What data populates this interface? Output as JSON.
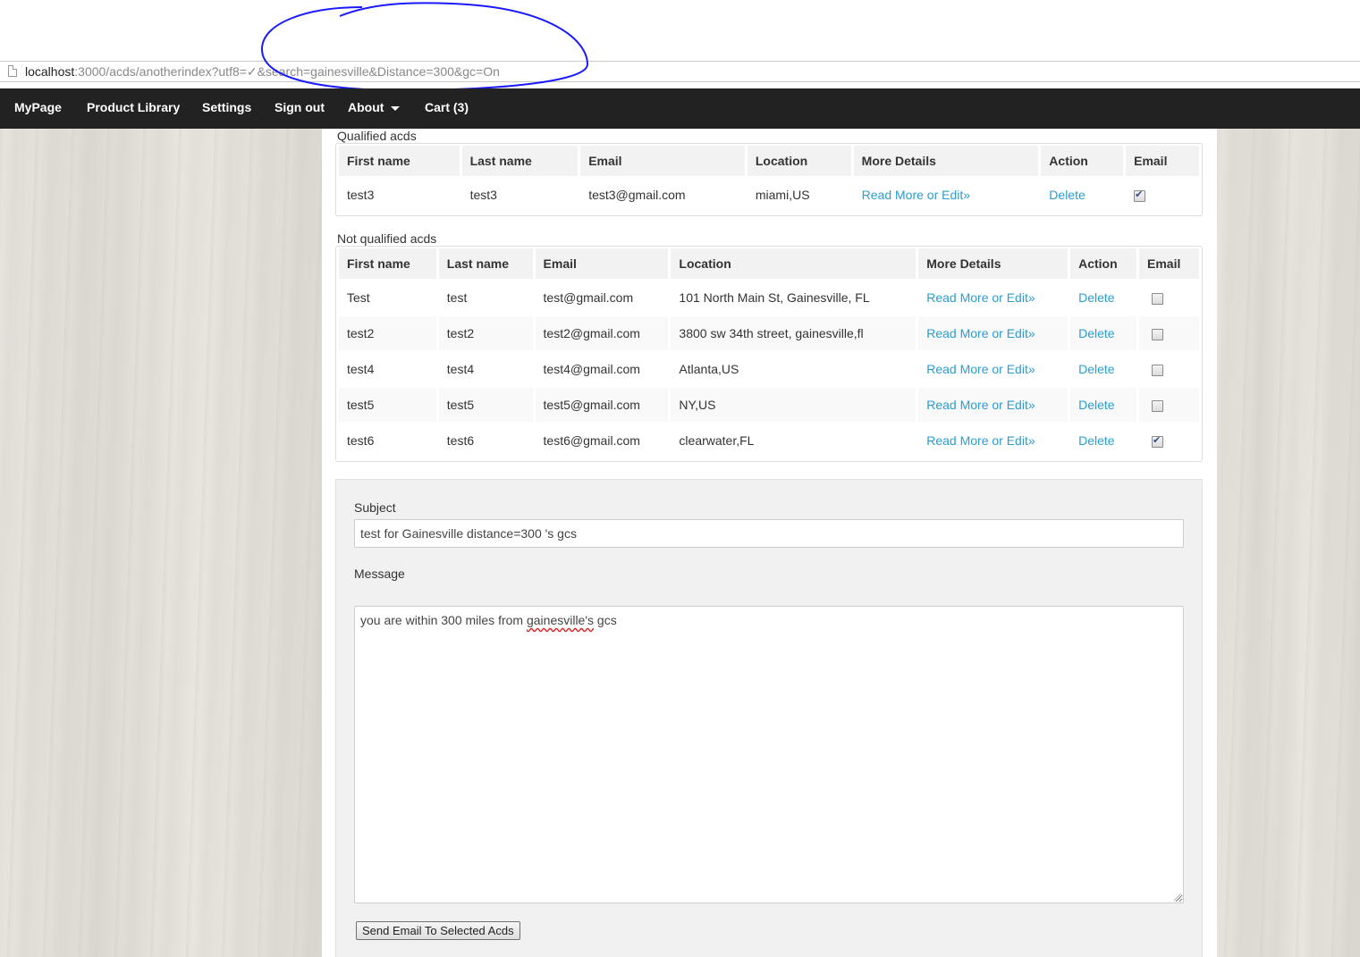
{
  "browser": {
    "url_host": "localhost",
    "url_rest": ":3000/acds/anotherindex?utf8=✓&search=gainesville&Distance=300&gc=On"
  },
  "navbar": {
    "items": [
      "MyPage",
      "Product Library",
      "Settings",
      "Sign out",
      "About",
      "Cart (3)"
    ]
  },
  "qualified": {
    "caption": "Qualified acds",
    "headers": [
      "First name",
      "Last name",
      "Email",
      "Location",
      "More Details",
      "Action",
      "Email"
    ],
    "rows": [
      {
        "first": "test3",
        "last": "test3",
        "email": "test3@gmail.com",
        "location": "miami,US",
        "details": "Read More or Edit»",
        "action": "Delete",
        "checked": true
      }
    ]
  },
  "not_qualified": {
    "caption": "Not qualified acds",
    "headers": [
      "First name",
      "Last name",
      "Email",
      "Location",
      "More Details",
      "Action",
      "Email"
    ],
    "rows": [
      {
        "first": "Test",
        "last": "test",
        "email": "test@gmail.com",
        "location": "101 North Main St, Gainesville, FL",
        "details": "Read More or Edit»",
        "action": "Delete",
        "checked": false
      },
      {
        "first": "test2",
        "last": "test2",
        "email": "test2@gmail.com",
        "location": "3800 sw 34th street, gainesville,fl",
        "details": "Read More or Edit»",
        "action": "Delete",
        "checked": false
      },
      {
        "first": "test4",
        "last": "test4",
        "email": "test4@gmail.com",
        "location": "Atlanta,US",
        "details": "Read More or Edit»",
        "action": "Delete",
        "checked": false
      },
      {
        "first": "test5",
        "last": "test5",
        "email": "test5@gmail.com",
        "location": "NY,US",
        "details": "Read More or Edit»",
        "action": "Delete",
        "checked": false
      },
      {
        "first": "test6",
        "last": "test6",
        "email": "test6@gmail.com",
        "location": "clearwater,FL",
        "details": "Read More or Edit»",
        "action": "Delete",
        "checked": true
      }
    ]
  },
  "form": {
    "subject_label": "Subject",
    "subject_value": "test for Gainesville distance=300 's gcs",
    "message_label": "Message",
    "message_prefix": "you are within 300 miles from ",
    "message_misspelled": "gainesville's",
    "message_suffix": " gcs",
    "send_label": "Send Email To Selected Acds"
  }
}
